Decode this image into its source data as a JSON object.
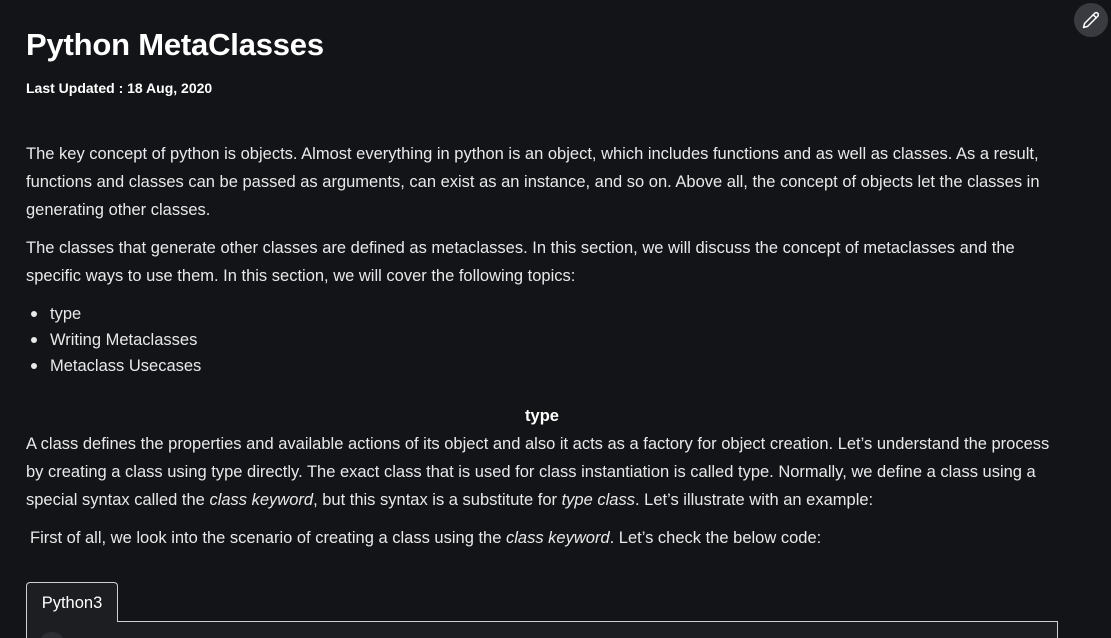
{
  "article": {
    "title": "Python MetaClasses",
    "last_updated": "Last Updated : 18 Aug, 2020",
    "paragraph_1": "The key concept of python is objects. Almost everything in python is an object, which includes functions and as well as classes. As a result, functions and classes can be passed as arguments, can exist as an instance, and so on. Above all, the concept of objects let the classes in generating other classes.",
    "paragraph_2": "The classes that generate other classes are defined as metaclasses. In this section, we will discuss the concept of metaclasses and the specific ways to use them. In this section, we will cover the following topics:",
    "topics": [
      "type",
      "Writing Metaclasses",
      "Metaclass Usecases"
    ],
    "section_heading": "type",
    "paragraph_3": {
      "part_1": "A class defines the properties and available actions of its object and also it acts as a factory for object creation. Let’s understand the process by creating a class using type directly. The exact class that is used for class instantiation is called type. Normally, we define a class using a special syntax called the ",
      "em_1": "class keyword",
      "part_2": ", but this syntax is a substitute for ",
      "em_2": "type class",
      "part_3": ". Let’s illustrate with an example:"
    },
    "paragraph_4": {
      "part_1": "First of all, we look into the scenario of creating a class using the ",
      "em_1": "class keyword",
      "part_2": ". Let’s check the below code:"
    }
  },
  "code_block": {
    "tab_label": "Python3"
  },
  "edit_button": {
    "icon": "pencil-icon"
  },
  "colors": {
    "background": "#131417",
    "text": "#e9e9ea",
    "heading": "#ffffff",
    "code_border": "#d0d0d0"
  }
}
